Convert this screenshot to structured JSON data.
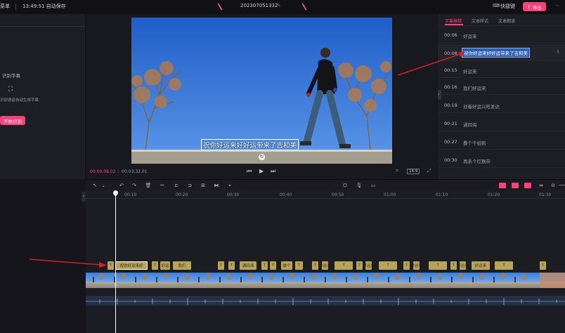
{
  "topbar": {
    "menu_label": "菜单",
    "time_autosave": "13:49:51 自动保存",
    "project_name": "202307051332",
    "shortcut_label": "快捷键",
    "export_label": "导出"
  },
  "leftpanel": {
    "section_title": "识别字幕",
    "desc": "识别语音自动生成字幕",
    "start_button": "开始识别"
  },
  "preview": {
    "subtitle_text": "祝你好运来好好运带来了吉和美",
    "timecode_current": "00:00:08.02",
    "timecode_total": "00:03:32.01",
    "ratio_label": "16:9"
  },
  "rightpanel": {
    "tabs": [
      "字幕编辑",
      "文本样式",
      "文本朗读"
    ],
    "rows": [
      {
        "time": "00:06",
        "text": "好运来"
      },
      {
        "time": "00:08",
        "text": "祝你好运来好好运带来了吉和美"
      },
      {
        "time": "00:15",
        "text": "好运来"
      },
      {
        "time": "00:16",
        "text": "我们好运来"
      },
      {
        "time": "00:19",
        "text": "迎着好运兴旺发达"
      },
      {
        "time": "00:21",
        "text": "通四海"
      },
      {
        "time": "00:27",
        "text": "叠个千纸鹤"
      },
      {
        "time": "00:30",
        "text": "再系个红飘带"
      }
    ]
  },
  "timeline": {
    "ruler_labels": [
      "00:10",
      "00:20",
      "00:30",
      "00:40",
      "00:50",
      "01:00",
      "01:10",
      "01:20",
      "01:30"
    ],
    "subtitle_clips": [
      {
        "label": "T"
      },
      {
        "label": "祝你好运来好"
      },
      {
        "label": "T"
      },
      {
        "label": "好运"
      },
      {
        "label": "我们"
      },
      {
        "label": "T"
      },
      {
        "label": "T"
      },
      {
        "label": "通四海"
      },
      {
        "label": "T"
      },
      {
        "label": "T"
      },
      {
        "label": "叠个"
      },
      {
        "label": "T"
      },
      {
        "label": "T"
      },
      {
        "label": "好运来"
      },
      {
        "label": "T"
      },
      {
        "label": "T"
      },
      {
        "label": "好运来"
      },
      {
        "label": "T"
      },
      {
        "label": "T"
      },
      {
        "label": "好运来"
      },
      {
        "label": "T"
      },
      {
        "label": "T"
      },
      {
        "label": "好运来"
      },
      {
        "label": "好运来"
      },
      {
        "label": "T"
      },
      {
        "label": "T"
      }
    ]
  },
  "colors": {
    "accent_pink": "#f5427a",
    "clip_gold": "#b8a35a",
    "sky_blue": "#2f6fd0",
    "annotation_red": "#d42020"
  }
}
